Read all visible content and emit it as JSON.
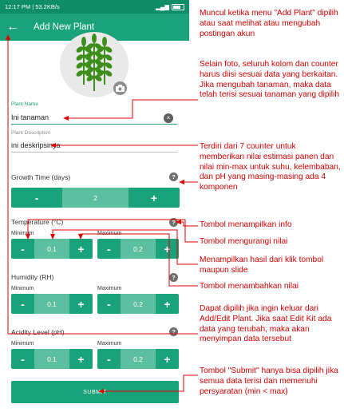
{
  "status": {
    "time": "12:17 PM",
    "data_speed": "53.2KB/s"
  },
  "appbar": {
    "title": "Add New Plant",
    "back_icon": "arrow-left-icon"
  },
  "form": {
    "plant_name_label": "Plant Name",
    "plant_name_value": "Ini tanaman",
    "plant_description_label": "Plant Description",
    "plant_description_value": "ini deskripsinya"
  },
  "growth": {
    "label": "Growth Time (days)",
    "value": "2"
  },
  "temperature": {
    "label": "Temperature (°C)",
    "min_label": "Minimum",
    "max_label": "Maximum",
    "min_value": "0.1",
    "max_value": "0.2"
  },
  "humidity": {
    "label": "Humidity (RH)",
    "min_label": "Minimum",
    "max_label": "Maximum",
    "min_value": "0.1",
    "max_value": "0.2"
  },
  "acidity": {
    "label": "Acidity Level (pH)",
    "min_label": "Minimum",
    "max_label": "Maximum",
    "min_value": "0.1",
    "max_value": "0.2"
  },
  "buttons": {
    "minus": "-",
    "plus": "+",
    "submit": "SUBMIT",
    "clear": "×",
    "info": "?"
  },
  "colors": {
    "primary": "#1aa27a",
    "primary_light": "#5cbf9f",
    "annotation": "#d40000"
  },
  "annotations": {
    "a1": "Muncul ketika menu \"Add Plant\" dipilih atau saat melihat atau mengubah postingan akun",
    "a2": "Selain foto, seluruh kolom dan counter harus diisi sesuai data yang berkaitan. Jika mengubah tanaman, maka data telah terisi sesuai tanaman yang dipilih",
    "a3": "Terdiri dari 7 counter untuk memberikan nilai estimasi panen dan nilai min-max untuk suhu, kelembaban, dan pH yang masing-masing ada 4 komponen",
    "a4": "Tombol menampilkan info",
    "a5": "Tombol mengurangi nilai",
    "a6": "Menampilkan hasil dari klik tombol maupun slide",
    "a7": "Tombol menambahkan nilai",
    "a8": "Dapat dipilih jika ingin keluar dari Add/Edit Plant. Jika saat Edit Kit ada data yang terubah, maka akan menyimpan data tersebut",
    "a9": "Tombol \"Submit\" hanya bisa dipilih jika semua data terisi dan memenuhi persyaratan (min < max)"
  }
}
